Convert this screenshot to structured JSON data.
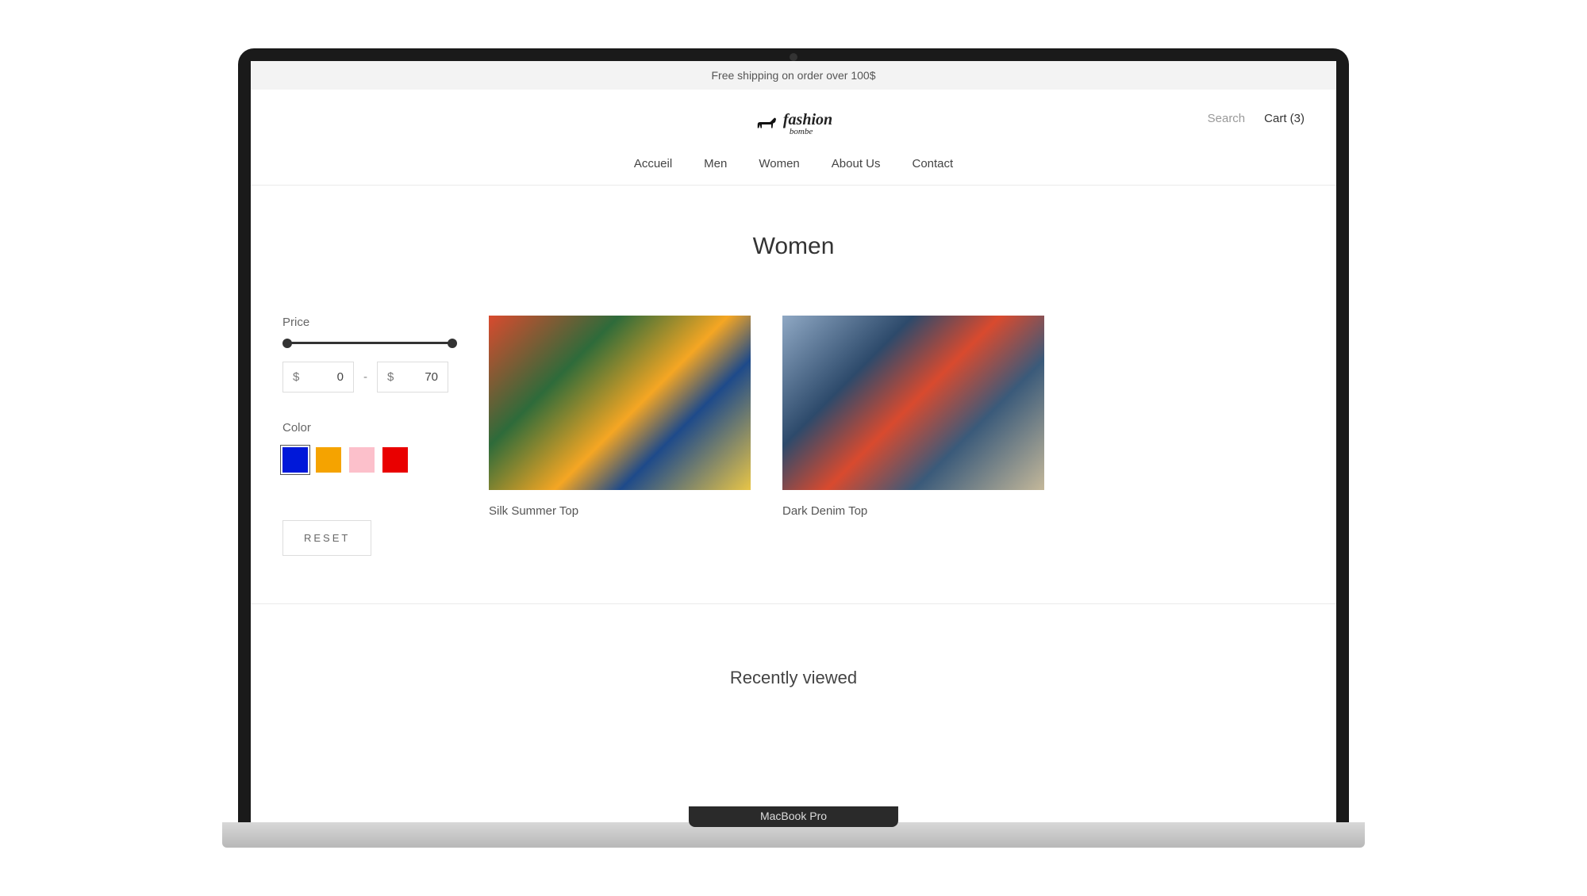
{
  "banner": "Free shipping on order over 100$",
  "logo": {
    "main": "fashion",
    "sub": "bombe"
  },
  "header": {
    "search_label": "Search",
    "cart_prefix": "Cart (",
    "cart_count": "3",
    "cart_suffix": ")"
  },
  "nav": {
    "items": [
      {
        "label": "Accueil"
      },
      {
        "label": "Men"
      },
      {
        "label": "Women"
      },
      {
        "label": "About Us"
      },
      {
        "label": "Contact"
      }
    ]
  },
  "page_title": "Women",
  "filters": {
    "price_label": "Price",
    "currency": "$",
    "price_min": "0",
    "price_max": "70",
    "separator": "-",
    "color_label": "Color",
    "colors": [
      {
        "name": "blue",
        "hex": "#0018d9",
        "selected": true
      },
      {
        "name": "orange",
        "hex": "#f5a300",
        "selected": false
      },
      {
        "name": "pink",
        "hex": "#fcc0cb",
        "selected": false
      },
      {
        "name": "red",
        "hex": "#e90000",
        "selected": false
      }
    ],
    "reset_label": "RESET"
  },
  "products": [
    {
      "name": "Silk Summer Top"
    },
    {
      "name": "Dark Denim Top"
    }
  ],
  "recently_viewed_label": "Recently viewed",
  "device_label": "MacBook Pro"
}
